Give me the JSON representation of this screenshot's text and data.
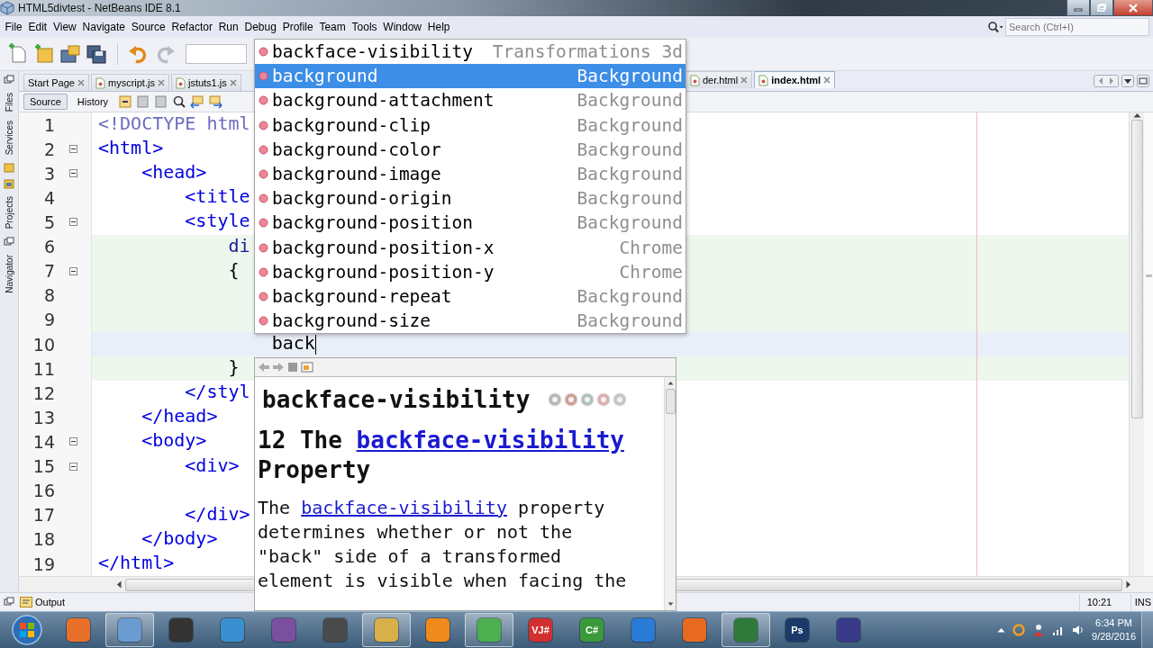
{
  "window": {
    "title": "HTML5divtest - NetBeans IDE 8.1"
  },
  "menu": [
    "File",
    "Edit",
    "View",
    "Navigate",
    "Source",
    "Refactor",
    "Run",
    "Debug",
    "Profile",
    "Team",
    "Tools",
    "Window",
    "Help"
  ],
  "search": {
    "placeholder": "Search (Ctrl+I)"
  },
  "side_tabs": [
    "Files",
    "Services",
    "Projects",
    "Navigator"
  ],
  "editor_tabs": [
    {
      "label": "Start Page",
      "selected": false
    },
    {
      "label": "myscript.js",
      "selected": false
    },
    {
      "label": "jstuts1.js",
      "selected": false
    },
    {
      "label": "der.html",
      "selected": false
    },
    {
      "label": "index.html",
      "selected": true
    }
  ],
  "view_modes": [
    {
      "label": "Source",
      "selected": true
    },
    {
      "label": "History",
      "selected": false
    }
  ],
  "code_lines": [
    {
      "number": "1",
      "text": "<!DOCTYPE html",
      "kind": "doctype",
      "fold": false,
      "modified": false,
      "current": false
    },
    {
      "number": "2",
      "text": "<html>",
      "kind": "tag",
      "fold": true,
      "modified": false,
      "current": false
    },
    {
      "number": "3",
      "text": "    <head>",
      "kind": "tag",
      "fold": true,
      "modified": false,
      "current": false
    },
    {
      "number": "4",
      "text": "        <title",
      "kind": "tag",
      "fold": false,
      "modified": false,
      "current": false
    },
    {
      "number": "5",
      "text": "        <style",
      "kind": "tag",
      "fold": true,
      "modified": false,
      "current": false
    },
    {
      "number": "6",
      "text": "            di",
      "kind": "css",
      "fold": false,
      "modified": true,
      "current": false
    },
    {
      "number": "7",
      "text": "            {",
      "kind": "plain",
      "fold": true,
      "modified": true,
      "current": false
    },
    {
      "number": "8",
      "fold": false,
      "modified": true,
      "current": false
    },
    {
      "number": "9",
      "fold": false,
      "modified": true,
      "current": false
    },
    {
      "number": "10",
      "text": "                back",
      "kind": "plain",
      "fold": false,
      "modified": false,
      "current": true
    },
    {
      "number": "11",
      "text": "            }",
      "kind": "plain",
      "fold": false,
      "modified": true,
      "current": false
    },
    {
      "number": "12",
      "text": "        </styl",
      "kind": "tag",
      "fold": false,
      "modified": false,
      "current": false
    },
    {
      "number": "13",
      "text": "    </head>",
      "kind": "tag",
      "fold": false,
      "modified": false,
      "current": false
    },
    {
      "number": "14",
      "text": "    <body>",
      "kind": "tag",
      "fold": true,
      "modified": false,
      "current": false
    },
    {
      "number": "15",
      "text": "        <div>",
      "kind": "tag",
      "fold": true,
      "modified": false,
      "current": false
    },
    {
      "number": "16",
      "fold": false,
      "modified": false,
      "current": false
    },
    {
      "number": "17",
      "text": "        </div>",
      "kind": "tag",
      "fold": false,
      "modified": false,
      "current": false
    },
    {
      "number": "18",
      "text": "    </body>",
      "kind": "tag",
      "fold": false,
      "modified": false,
      "current": false
    },
    {
      "number": "19",
      "text": "</html>",
      "kind": "tag",
      "fold": false,
      "modified": false,
      "current": false
    }
  ],
  "completion": [
    {
      "name": "backface-visibility",
      "category": "Transformations 3d",
      "selected": false
    },
    {
      "name": "background",
      "category": "Background",
      "selected": true
    },
    {
      "name": "background-attachment",
      "category": "Background",
      "selected": false
    },
    {
      "name": "background-clip",
      "category": "Background",
      "selected": false
    },
    {
      "name": "background-color",
      "category": "Background",
      "selected": false
    },
    {
      "name": "background-image",
      "category": "Background",
      "selected": false
    },
    {
      "name": "background-origin",
      "category": "Background",
      "selected": false
    },
    {
      "name": "background-position",
      "category": "Background",
      "selected": false
    },
    {
      "name": "background-position-x",
      "category": "Chrome",
      "selected": false
    },
    {
      "name": "background-position-y",
      "category": "Chrome",
      "selected": false
    },
    {
      "name": "background-repeat",
      "category": "Background",
      "selected": false
    },
    {
      "name": "background-size",
      "category": "Background",
      "selected": false
    }
  ],
  "doc": {
    "title": "backface-visibility",
    "heading": {
      "before": "12 The",
      "link": "backface-visibility",
      "after": "Property"
    },
    "paragraph": {
      "before": "The",
      "link": "backface-visibility",
      "after": "property determines whether or not the \"back\" side of a transformed element is visible when facing the"
    }
  },
  "status_bar": {
    "output": "Output",
    "position": "10:21",
    "mode": "INS"
  },
  "taskbar": {
    "apps": [
      {
        "color": "#e8702a",
        "selected": false
      },
      {
        "color": "#6a9bd1",
        "selected": true
      },
      {
        "color": "#333333",
        "selected": false
      },
      {
        "color": "#3a8fd0",
        "selected": false
      },
      {
        "color": "#7a4fa0",
        "selected": false
      },
      {
        "color": "#4a4a4a",
        "selected": false
      },
      {
        "color": "#d8b04a",
        "selected": true
      },
      {
        "color": "#f08a1c",
        "selected": false
      },
      {
        "color": "#4caf50",
        "selected": true
      },
      {
        "color": "#d03030",
        "selected": false,
        "glyph": "VJ#"
      },
      {
        "color": "#3a9a3a",
        "selected": false,
        "glyph": "C#"
      },
      {
        "color": "#2a7ad8",
        "selected": false
      },
      {
        "color": "#e86a20",
        "selected": false
      },
      {
        "color": "#2f7a3a",
        "selected": true
      },
      {
        "color": "#1b3a6a",
        "selected": false,
        "glyph": "Ps"
      },
      {
        "color": "#3a3a8a",
        "selected": false
      }
    ],
    "time": "6:34 PM",
    "date": "9/28/2016"
  }
}
